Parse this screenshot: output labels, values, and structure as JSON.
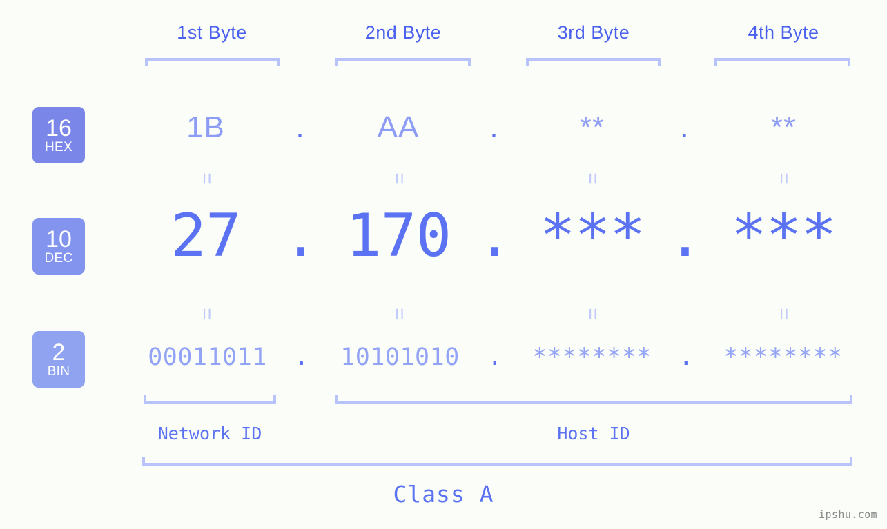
{
  "page": {
    "background_color": "#fbfdf8",
    "accent_color": "#5b73f2",
    "bracket_color": "#b8c2fb",
    "watermark": "ipshu.com"
  },
  "byte_headers": [
    {
      "label": "1st Byte"
    },
    {
      "label": "2nd Byte"
    },
    {
      "label": "3rd Byte"
    },
    {
      "label": "4th Byte"
    }
  ],
  "bases": [
    {
      "number": "16",
      "name": "HEX",
      "color": "#7b87e8"
    },
    {
      "number": "10",
      "name": "DEC",
      "color": "#8394ee"
    },
    {
      "number": "2",
      "name": "BIN",
      "color": "#8fa3f0"
    }
  ],
  "separators": {
    "dot": ".",
    "equals": "="
  },
  "rows": {
    "hex": {
      "base_label": "HEX",
      "values": [
        "1B",
        "AA",
        "**",
        "**"
      ]
    },
    "dec": {
      "base_label": "DEC",
      "values": [
        "27",
        "170",
        "***",
        "***"
      ]
    },
    "bin": {
      "base_label": "BIN",
      "values": [
        "00011011",
        "10101010",
        "********",
        "********"
      ]
    }
  },
  "id_sections": [
    {
      "label": "Network ID"
    },
    {
      "label": "Host ID"
    }
  ],
  "class": {
    "label": "Class A"
  }
}
